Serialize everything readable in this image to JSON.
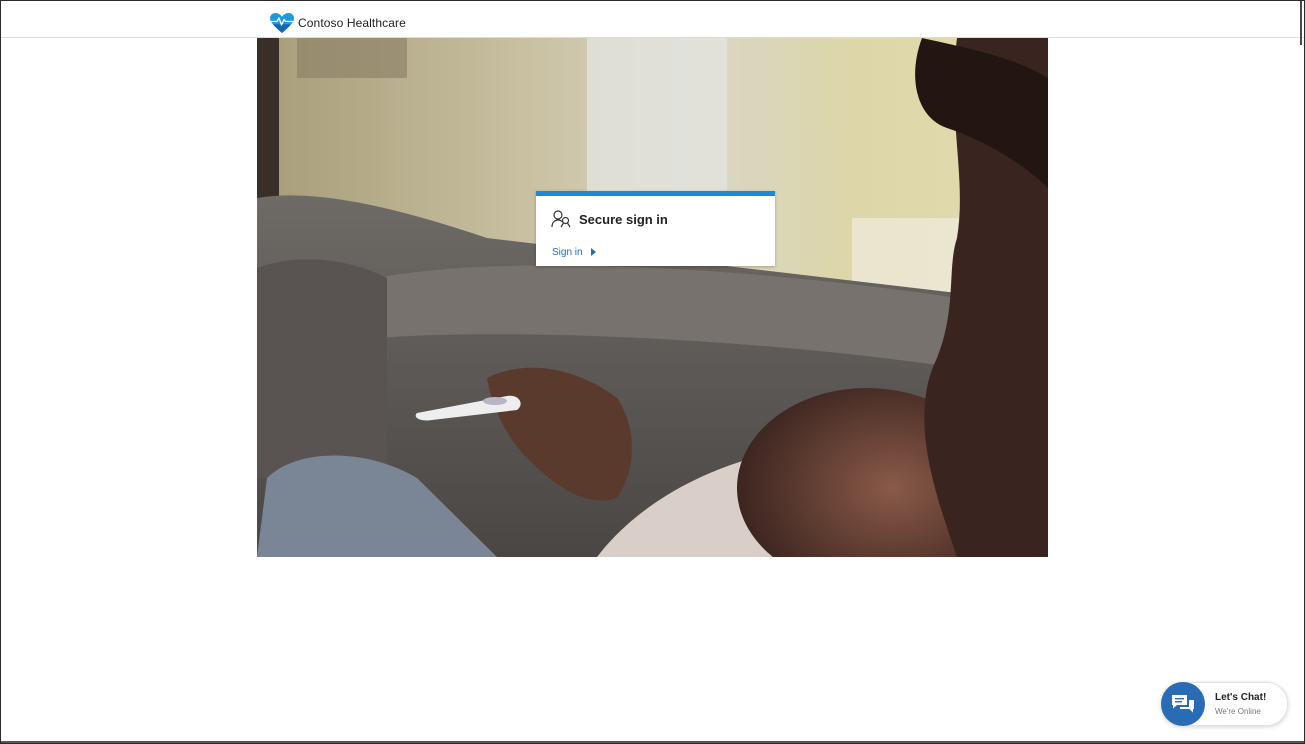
{
  "header": {
    "brand_name": "Contoso Healthcare",
    "brand_icon": "heart-pulse-icon",
    "brand_color": "#1b9ae0"
  },
  "hero": {
    "image": "parent-checking-child-temperature-photo"
  },
  "signin_card": {
    "title": "Secure sign in",
    "title_icon": "secure-sign-in-people-icon",
    "link_label": "Sign in",
    "link_icon": "caret-right-icon",
    "accent_color": "#1b88d8"
  },
  "chat": {
    "title": "Let's Chat!",
    "status": "We're Online",
    "icon": "chat-bubbles-icon",
    "bubble_color": "#2a6bb5"
  }
}
